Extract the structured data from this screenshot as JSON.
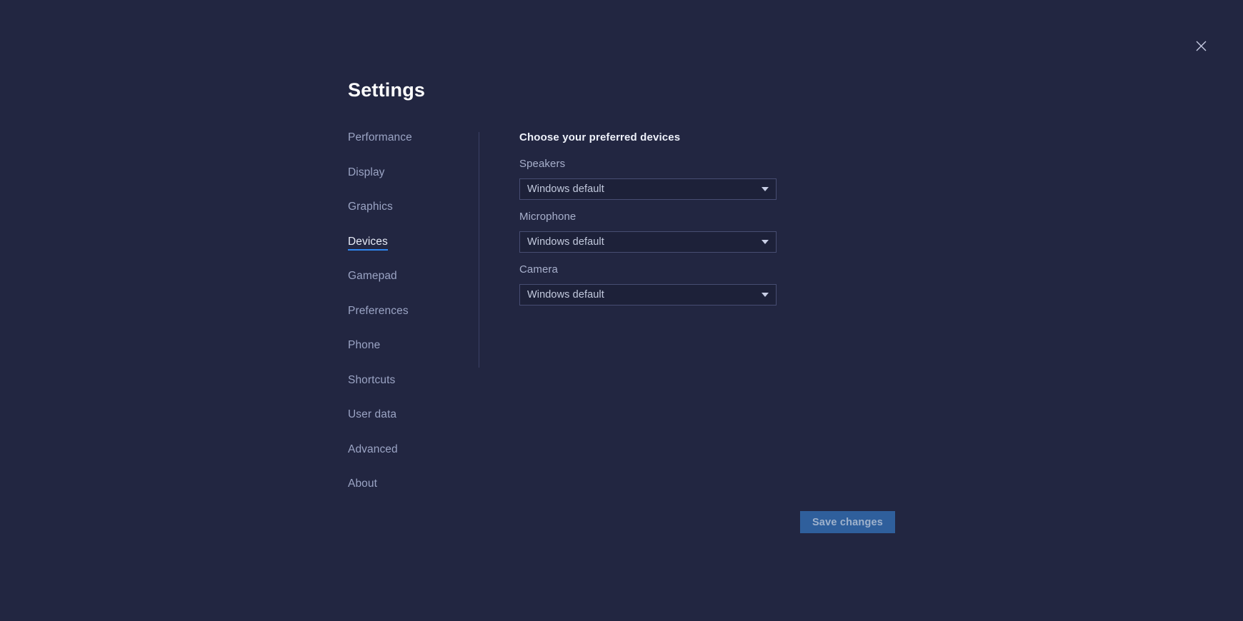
{
  "window": {
    "close_icon": "close-icon"
  },
  "page": {
    "title": "Settings"
  },
  "sidebar": {
    "items": [
      {
        "label": "Performance",
        "active": false
      },
      {
        "label": "Display",
        "active": false
      },
      {
        "label": "Graphics",
        "active": false
      },
      {
        "label": "Devices",
        "active": true
      },
      {
        "label": "Gamepad",
        "active": false
      },
      {
        "label": "Preferences",
        "active": false
      },
      {
        "label": "Phone",
        "active": false
      },
      {
        "label": "Shortcuts",
        "active": false
      },
      {
        "label": "User data",
        "active": false
      },
      {
        "label": "Advanced",
        "active": false
      },
      {
        "label": "About",
        "active": false
      }
    ]
  },
  "content": {
    "heading": "Choose your preferred devices",
    "fields": [
      {
        "label": "Speakers",
        "value": "Windows default",
        "arrow_icon": "chevron-down-icon"
      },
      {
        "label": "Microphone",
        "value": "Windows default",
        "arrow_icon": "chevron-down-icon"
      },
      {
        "label": "Camera",
        "value": "Windows default",
        "arrow_icon": "chevron-down-icon"
      }
    ]
  },
  "footer": {
    "save_label": "Save changes",
    "save_enabled": false
  },
  "colors": {
    "background": "#222641",
    "accent": "#2f86f0",
    "button": "#2f5f9c",
    "text_primary": "#eef1fa",
    "text_muted": "#9ba4c4",
    "divider": "#3b4066"
  }
}
